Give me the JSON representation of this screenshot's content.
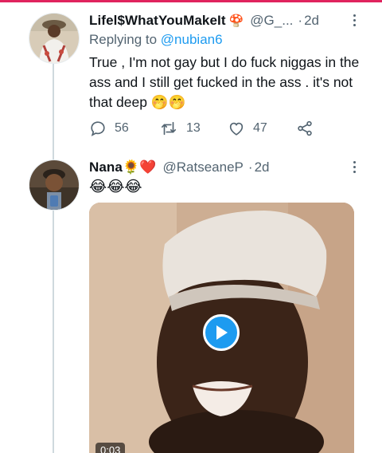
{
  "tweets": [
    {
      "name": "Lifel$WhatYouMakeIt",
      "handle": "@G_...",
      "separator": "·",
      "time": "2d",
      "replying_label": "Replying to",
      "replying_to": "@nubian6",
      "text": "True , I'm not gay but I do fuck niggas in the ass and I still get fucked in the ass . it's not that deep 🤭🤭",
      "replies": "56",
      "retweets": "13",
      "likes": "47"
    },
    {
      "name": "Nana🌻❤️",
      "handle": "@RatseaneP",
      "separator": "·",
      "time": "2d",
      "text": "😂😂😂",
      "video_duration": "0:03"
    }
  ],
  "colors": {
    "accent": "#1d9bf0",
    "secondary_text": "#536471",
    "thread_line": "#cfd9de"
  }
}
